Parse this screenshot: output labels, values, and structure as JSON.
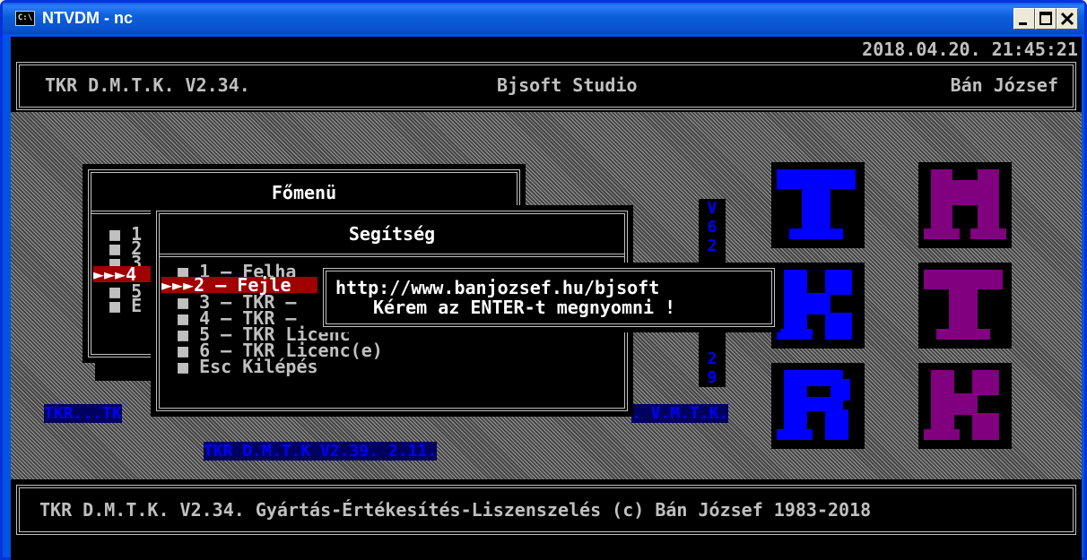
{
  "window": {
    "title": "NTVDM - nc",
    "icon_text": "C:\\"
  },
  "status": {
    "datetime": "2018.04.20. 21:45:21"
  },
  "header": {
    "left": "TKR D.M.T.K. V2.34.",
    "center": "Bjsoft Studio",
    "right": "Bán József"
  },
  "main_menu": {
    "title": "Főmenü",
    "items": [
      "■ 1",
      "■ 2",
      "■ 3",
      "►►►4",
      "■ 5",
      "■ E"
    ]
  },
  "help_menu": {
    "title": "Segítség",
    "items": [
      "■ 1 – Felha",
      "►►►2 – Fejle",
      "■ 3 – TKR –",
      "■ 4 – TKR –",
      "■ 5 – TKR Licenc",
      "■ 6 – TKR Licenc(e)",
      "■ Esc Kilépés"
    ]
  },
  "dialog": {
    "line1": "http://www.banjozsef.hu/bjsoft",
    "line2_pre": "Kérem az ",
    "line2_key": "ENTER",
    "line2_post": "-t megnyomni !"
  },
  "side_letters": [
    "V",
    "6",
    "2",
    "",
    "",
    "",
    "",
    "",
    "2",
    "9"
  ],
  "blue_labels": {
    "left": "TKR...TK",
    "right": ". V.M.T.K.",
    "version": "TKR D.M.T.K V2.39. 2.11."
  },
  "logo_letters": [
    {
      "letter": "T",
      "color": "#0000ff"
    },
    {
      "letter": "M",
      "color": "#800080"
    },
    {
      "letter": "K",
      "color": "#0000ff"
    },
    {
      "letter": "T",
      "color": "#800080"
    },
    {
      "letter": "R",
      "color": "#0000ff"
    },
    {
      "letter": "K",
      "color": "#800080"
    }
  ],
  "footer": {
    "text": "TKR D.M.T.K. V2.34. Gyártás-Értékesítés-Liszenszelés (c) Bán József 1983-2018"
  }
}
